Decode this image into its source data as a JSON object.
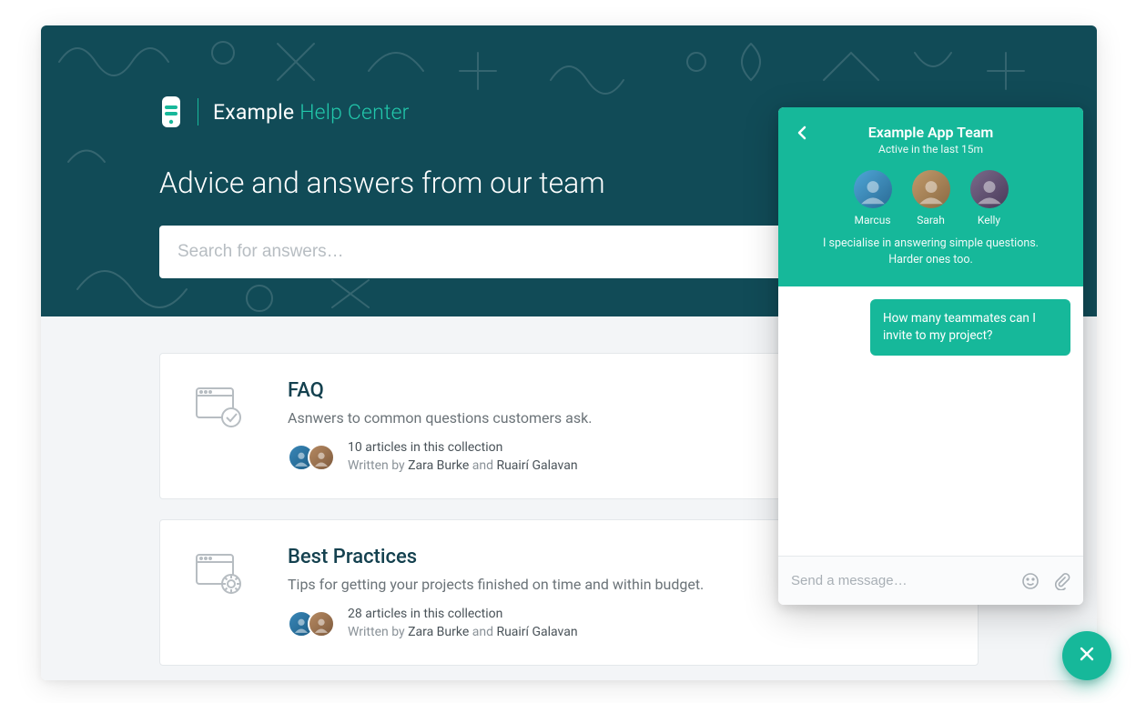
{
  "brand": {
    "name": "Example",
    "section": "Help Center"
  },
  "hero": {
    "title": "Advice and answers from our team",
    "search_placeholder": "Search for answers…"
  },
  "collections": [
    {
      "title": "FAQ",
      "description": "Asnwers to common questions customers ask.",
      "count_label": "10 articles in this collection",
      "written_by_prefix": "Written by ",
      "author1": "Zara Burke",
      "and": " and ",
      "author2": "Ruairí Galavan"
    },
    {
      "title": "Best Practices",
      "description": "Tips for getting your projects finished on time and within budget.",
      "count_label": "28 articles in this collection",
      "written_by_prefix": "Written by ",
      "author1": "Zara Burke",
      "and": " and ",
      "author2": "Ruairí Galavan"
    }
  ],
  "chat": {
    "team_name": "Example App Team",
    "status": "Active in the last 15m",
    "members": [
      {
        "name": "Marcus"
      },
      {
        "name": "Sarah"
      },
      {
        "name": "Kelly"
      }
    ],
    "tagline": "I specialise in answering simple questions. Harder ones too.",
    "outgoing_message": "How many teammates can I invite to my project?",
    "compose_placeholder": "Send a message…"
  },
  "colors": {
    "accent": "#16b89a",
    "hero_bg": "#114b57"
  }
}
